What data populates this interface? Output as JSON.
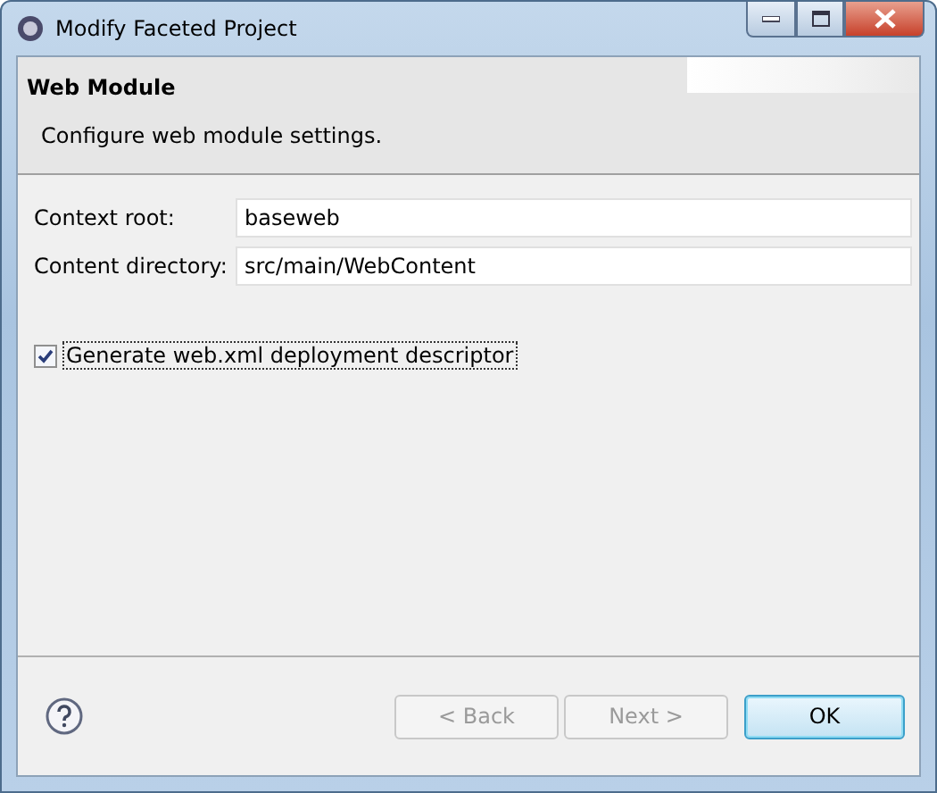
{
  "window": {
    "title": "Modify Faceted Project"
  },
  "header": {
    "title": "Web Module",
    "description": "Configure web module settings."
  },
  "fields": [
    {
      "label": "Context root:",
      "value": "baseweb"
    },
    {
      "label": "Content directory:",
      "value": "src/main/WebContent"
    }
  ],
  "checkbox": {
    "label": "Generate web.xml deployment descriptor",
    "checked": true
  },
  "buttons": [
    {
      "label": "< Back",
      "disabled": true,
      "default": false
    },
    {
      "label": "Next >",
      "disabled": true,
      "default": false
    },
    {
      "label": "OK",
      "disabled": false,
      "default": true
    }
  ]
}
